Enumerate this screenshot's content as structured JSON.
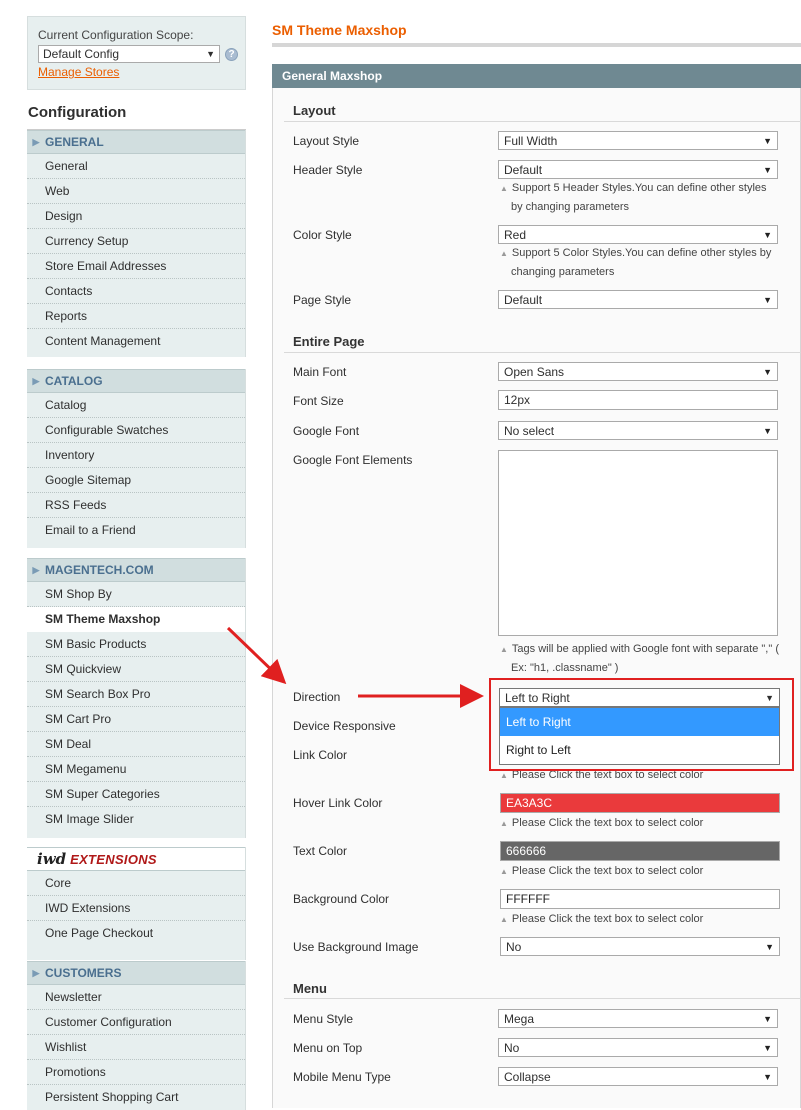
{
  "sidebar": {
    "scope_label": "Current Configuration Scope:",
    "scope_value": "Default Config",
    "manage_stores": "Manage Stores",
    "config_title": "Configuration",
    "groups": {
      "general": {
        "title": "GENERAL",
        "items": [
          "General",
          "Web",
          "Design",
          "Currency Setup",
          "Store Email Addresses",
          "Contacts",
          "Reports",
          "Content Management"
        ]
      },
      "catalog": {
        "title": "CATALOG",
        "items": [
          "Catalog",
          "Configurable Swatches",
          "Inventory",
          "Google Sitemap",
          "RSS Feeds",
          "Email to a Friend"
        ]
      },
      "magentech": {
        "title": "MAGENTECH.COM",
        "items": [
          "SM Shop By",
          "SM Theme Maxshop",
          "SM Basic Products",
          "SM Quickview",
          "SM Search Box Pro",
          "SM Cart Pro",
          "SM Deal",
          "SM Megamenu",
          "SM Super Categories",
          "SM Image Slider"
        ]
      },
      "iwd": {
        "logo": "iwd",
        "title": "EXTENSIONS",
        "items": [
          "Core",
          "IWD Extensions",
          "One Page Checkout"
        ]
      },
      "customers": {
        "title": "CUSTOMERS",
        "items": [
          "Newsletter",
          "Customer Configuration",
          "Wishlist",
          "Promotions",
          "Persistent Shopping Cart"
        ]
      }
    }
  },
  "main": {
    "page_title": "SM Theme Maxshop",
    "section_title": "General Maxshop",
    "layout": {
      "title": "Layout",
      "layout_style": {
        "label": "Layout Style",
        "value": "Full Width"
      },
      "header_style": {
        "label": "Header Style",
        "value": "Default",
        "note1": "Support 5 Header Styles.You can define other styles",
        "note2": "by changing parameters"
      },
      "color_style": {
        "label": "Color Style",
        "value": "Red",
        "note1": "Support 5 Color Styles.You can define other styles by",
        "note2": "changing parameters"
      },
      "page_style": {
        "label": "Page Style",
        "value": "Default"
      }
    },
    "entire_page": {
      "title": "Entire Page",
      "main_font": {
        "label": "Main Font",
        "value": "Open Sans"
      },
      "font_size": {
        "label": "Font Size",
        "value": "12px"
      },
      "google_font": {
        "label": "Google Font",
        "value": "No select"
      },
      "google_font_elements": {
        "label": "Google Font Elements",
        "value": "",
        "note1": "Tags will be applied with Google font with separate \",\" (",
        "note2": "Ex: \"h1, .classname\" )"
      },
      "direction": {
        "label": "Direction",
        "value": "Left to Right",
        "options": [
          "Left to Right",
          "Right to Left"
        ]
      },
      "device_responsive": {
        "label": "Device Responsive"
      },
      "link_color": {
        "label": "Link Color",
        "note": "Please Click the text box to select color"
      },
      "hover_link_color": {
        "label": "Hover Link Color",
        "value": "EA3A3C",
        "note": "Please Click the text box to select color"
      },
      "text_color": {
        "label": "Text Color",
        "value": "666666",
        "note": "Please Click the text box to select color"
      },
      "background_color": {
        "label": "Background Color",
        "value": "FFFFFF",
        "note": "Please Click the text box to select color"
      },
      "use_bg_image": {
        "label": "Use Background Image",
        "value": "No"
      }
    },
    "menu": {
      "title": "Menu",
      "menu_style": {
        "label": "Menu Style",
        "value": "Mega"
      },
      "menu_on_top": {
        "label": "Menu on Top",
        "value": "No"
      },
      "mobile_menu_type": {
        "label": "Mobile Menu Type",
        "value": "Collapse"
      }
    }
  },
  "colors": {
    "accent": "#eb5e00",
    "section_header": "#6f8992",
    "hover_link_swatch": "#ea3a3c",
    "text_color_swatch": "#666666",
    "background_swatch": "#ffffff",
    "annotation_red": "#e02020",
    "selected_option": "#3399ff"
  }
}
